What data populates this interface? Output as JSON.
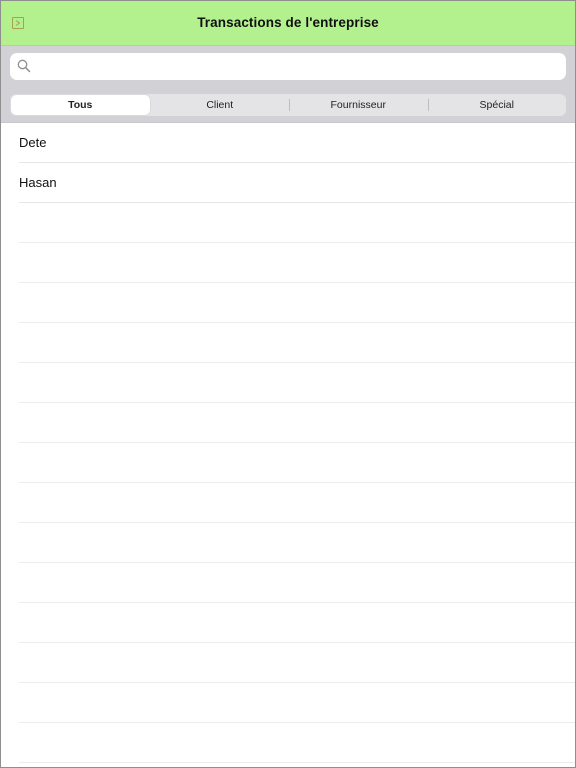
{
  "header": {
    "title": "Transactions de l'entreprise",
    "menu_icon": "sidebar-toggle-icon",
    "background": "#b3f08e"
  },
  "search": {
    "value": "",
    "placeholder": "",
    "icon": "search-icon"
  },
  "segments": {
    "items": [
      {
        "label": "Tous",
        "selected": true
      },
      {
        "label": "Client",
        "selected": false
      },
      {
        "label": "Fournisseur",
        "selected": false
      },
      {
        "label": "Spécial",
        "selected": false
      }
    ]
  },
  "list": {
    "items": [
      {
        "label": "Dete"
      },
      {
        "label": "Hasan"
      }
    ]
  }
}
